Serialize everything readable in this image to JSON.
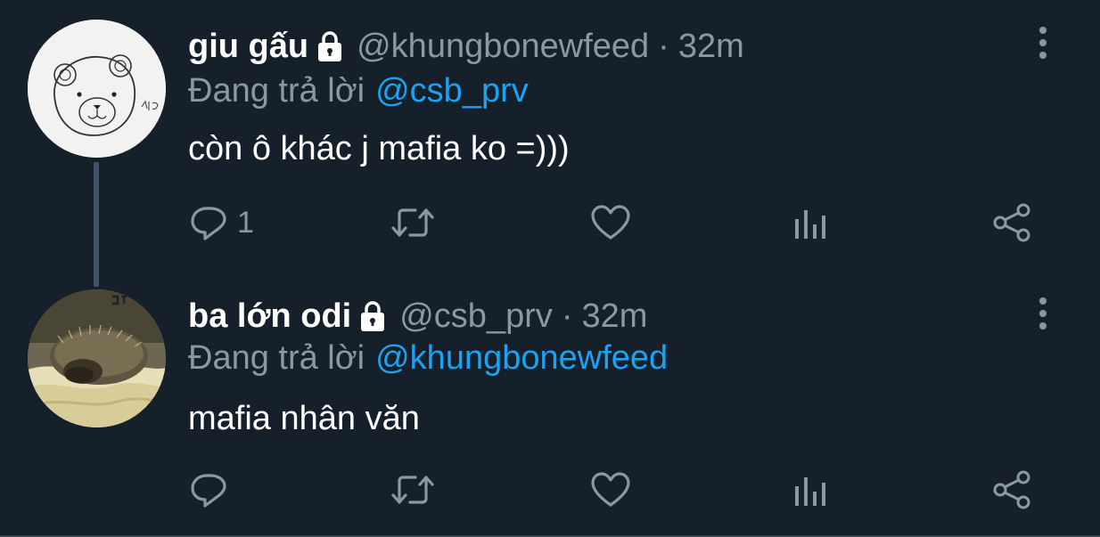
{
  "tweets": [
    {
      "display_name": "giu gấu",
      "handle": "@khungbonewfeed",
      "separator": "·",
      "time": "32m",
      "reply_prefix": "Đang trả lời",
      "reply_to": "@csb_prv",
      "text": "còn ô khác j mafia ko =)))",
      "reply_count": "1",
      "protected": true,
      "avatar": "bear-drawing"
    },
    {
      "display_name": "ba lớn odi",
      "handle": "@csb_prv",
      "separator": "·",
      "time": "32m",
      "reply_prefix": "Đang trả lời",
      "reply_to": "@khungbonewfeed",
      "text": "mafia nhân văn",
      "reply_count": "",
      "protected": true,
      "avatar": "hedgehog-photo"
    }
  ],
  "colors": {
    "background": "#15202b",
    "primary_text": "#ffffff",
    "secondary_text": "#8899a6",
    "accent": "#1da1f2",
    "thread_line": "#3d5466"
  },
  "icons": [
    "lock-icon",
    "more-vertical-icon",
    "reply-icon",
    "retweet-icon",
    "like-icon",
    "analytics-icon",
    "share-icon"
  ]
}
